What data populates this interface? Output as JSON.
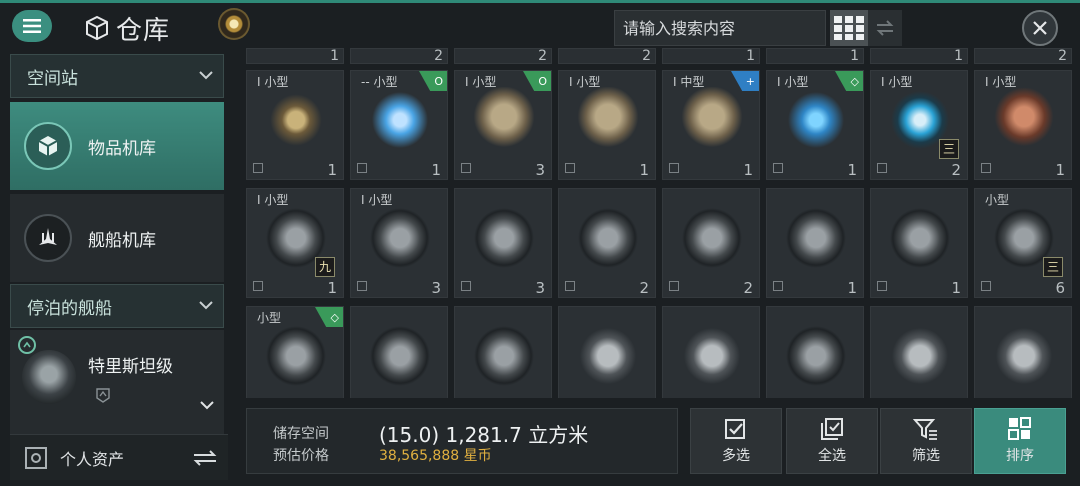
{
  "header": {
    "title": "仓库",
    "search_placeholder": "请输入搜索内容"
  },
  "sidebar": {
    "section_station": "空间站",
    "item_hangar": "物品机库",
    "item_ship_hangar": "舰船机库",
    "section_docked": "停泊的舰船",
    "docked_ship": "特里斯坦级",
    "personal_assets": "个人资产"
  },
  "top_row_counts": [
    "1",
    "2",
    "2",
    "2",
    "1",
    "1",
    "1",
    "2"
  ],
  "items_row1": [
    {
      "size": "I 小型",
      "tier": "",
      "qty": "1"
    },
    {
      "size": "-- 小型",
      "tier": "O",
      "qty": "1"
    },
    {
      "size": "I 小型",
      "tier": "O",
      "qty": "3"
    },
    {
      "size": "I 小型",
      "tier": "",
      "qty": "1"
    },
    {
      "size": "I 中型",
      "tier": "+",
      "qty": "1"
    },
    {
      "size": "I 小型",
      "tier": "◇",
      "qty": "1"
    },
    {
      "size": "I 小型",
      "tier": "",
      "qty": "2",
      "rank": "三"
    },
    {
      "size": "I 小型",
      "tier": "",
      "qty": "1"
    }
  ],
  "items_row2": [
    {
      "size": "I 小型",
      "tier": "",
      "qty": "1",
      "rank": "九"
    },
    {
      "size": "I 小型",
      "tier": "",
      "qty": "3"
    },
    {
      "size": "",
      "tier": "",
      "qty": "3"
    },
    {
      "size": "",
      "tier": "",
      "qty": "2"
    },
    {
      "size": "",
      "tier": "",
      "qty": "2"
    },
    {
      "size": "",
      "tier": "",
      "qty": "1"
    },
    {
      "size": "",
      "tier": "",
      "qty": "1"
    },
    {
      "size": "小型",
      "tier": "",
      "qty": "6",
      "rank": "三"
    }
  ],
  "items_row3": [
    {
      "size": "小型",
      "tier": "◇",
      "qty": ""
    },
    {
      "size": "",
      "tier": "",
      "qty": ""
    },
    {
      "size": "",
      "tier": "",
      "qty": ""
    },
    {
      "size": "",
      "tier": "",
      "qty": ""
    },
    {
      "size": "",
      "tier": "",
      "qty": ""
    },
    {
      "size": "",
      "tier": "",
      "qty": ""
    },
    {
      "size": "",
      "tier": "",
      "qty": ""
    },
    {
      "size": "",
      "tier": "",
      "qty": ""
    }
  ],
  "storage": {
    "label_space": "储存空间",
    "label_price": "预估价格",
    "value_space": "(15.0) 1,281.7 立方米",
    "value_price": "38,565,888 星币"
  },
  "actions": {
    "multi_select": "多选",
    "select_all": "全选",
    "filter": "筛选",
    "sort": "排序"
  },
  "colors": {
    "accent": "#3a8b7d",
    "tier_green": "#3a9a5a",
    "tier_blue": "#2f7fc4",
    "price_gold": "#e0b040"
  }
}
